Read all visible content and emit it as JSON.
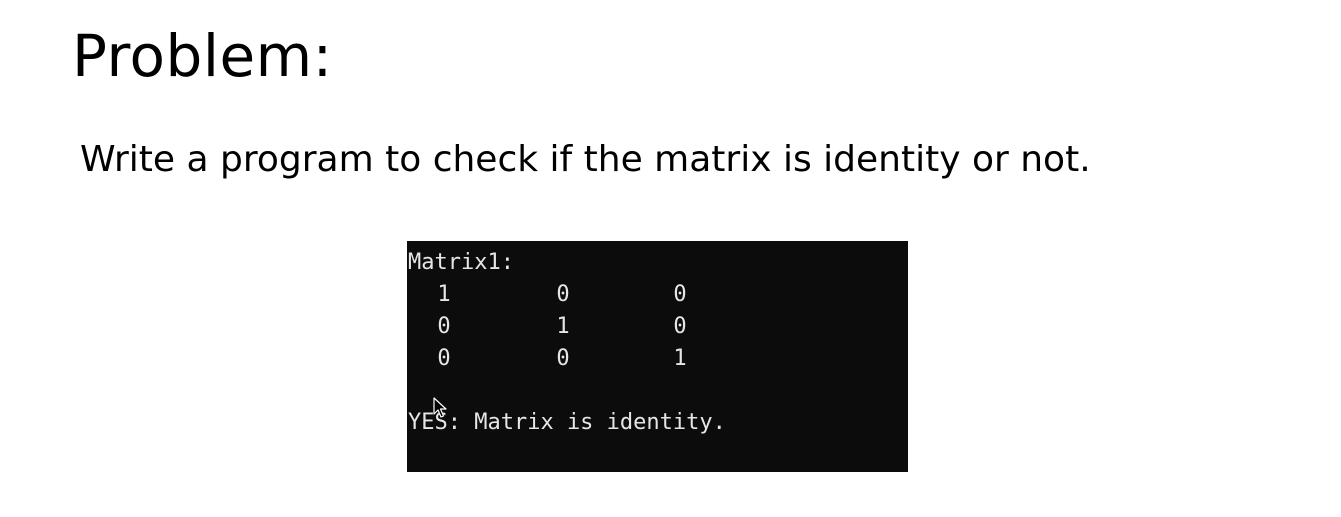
{
  "slide": {
    "title": "Problem:",
    "statement": "Write a program to check if the matrix is identity or not."
  },
  "console": {
    "background": "#0c0c0c",
    "text_color": "#e6e6e6",
    "header": "Matrix1:",
    "rows": [
      [
        "1",
        "0",
        "0"
      ],
      [
        "0",
        "1",
        "0"
      ],
      [
        "0",
        "0",
        "1"
      ]
    ],
    "result": "YES: Matrix is identity."
  },
  "pointer": {
    "icon": "mouse-pointer-icon"
  }
}
